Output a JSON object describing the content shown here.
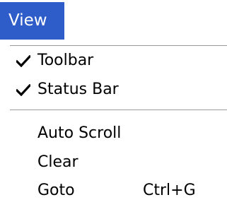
{
  "menubar": {
    "title": "View"
  },
  "menu": {
    "items": [
      {
        "label": "Toolbar",
        "checked": true,
        "icon": "checkmark-icon"
      },
      {
        "label": "Status Bar",
        "checked": true,
        "icon": "checkmark-icon"
      },
      {
        "label": "Auto Scroll",
        "checked": false
      },
      {
        "label": "Clear",
        "checked": false
      },
      {
        "label": "Goto",
        "checked": false,
        "shortcut": "Ctrl+G"
      }
    ]
  },
  "colors": {
    "menubar_highlight": "#2e5cc8",
    "menubar_text": "#ffffff",
    "separator": "#9a9a9a"
  }
}
